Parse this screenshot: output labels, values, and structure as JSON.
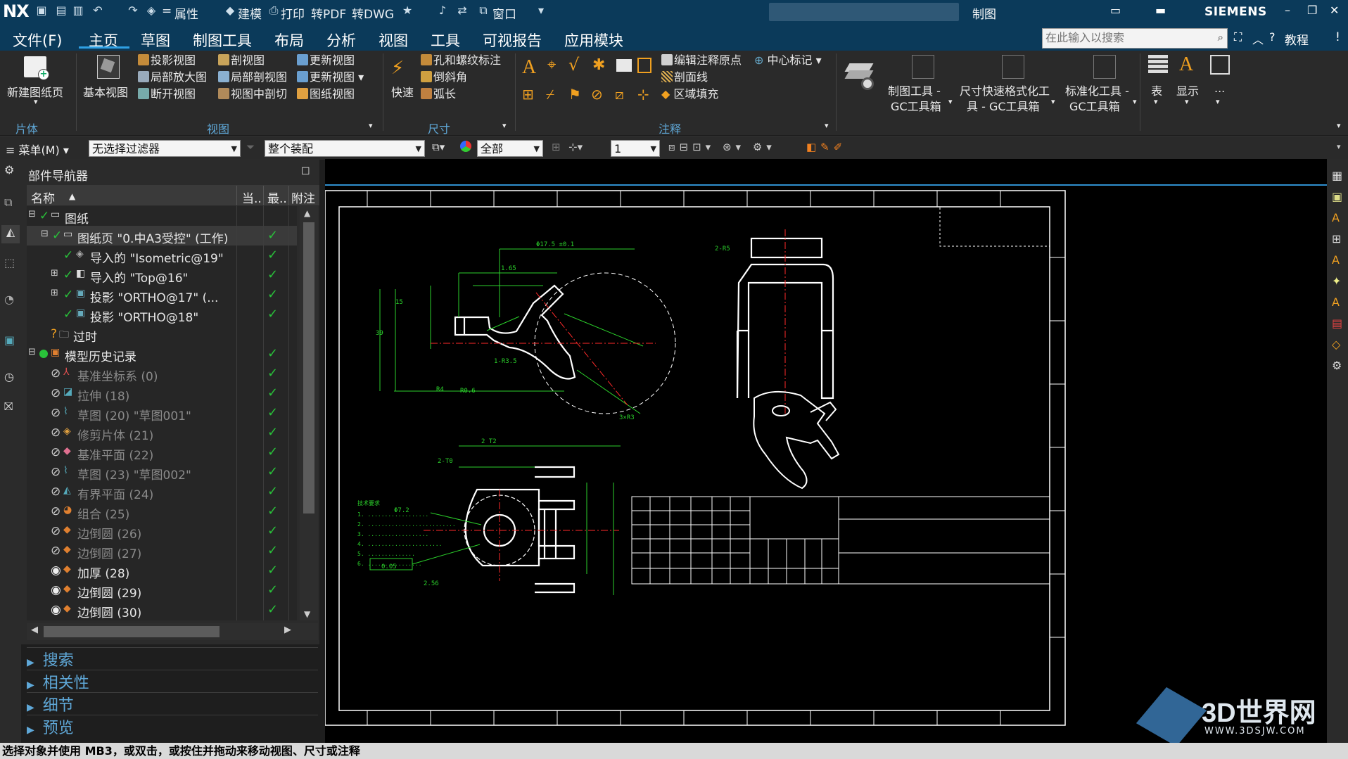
{
  "app": {
    "logo": "NX",
    "title": "制图",
    "brand": "SIEMENS"
  },
  "quick_access": {
    "properties": "属性",
    "model": "建模",
    "print": "打印",
    "to_pdf": "转PDF",
    "to_dwg": "转DWG",
    "window": "窗口"
  },
  "menu": {
    "file": "文件(F)",
    "tabs": [
      "主页",
      "草图",
      "制图工具",
      "布局",
      "分析",
      "视图",
      "工具",
      "可视报告",
      "应用模块"
    ],
    "active_tab": "主页",
    "search_placeholder": "在此输入以搜索",
    "tutorial": "教程"
  },
  "ribbon": {
    "new_sheet": "新建图纸页",
    "base_view": "基本视图",
    "projected_view": "投影视图",
    "detail_view": "局部放大图",
    "break_view": "断开视图",
    "section_view": "剖视图",
    "local_section": "局部剖视图",
    "view_in_section": "视图中剖切",
    "update_view_1": "更新视图",
    "update_view_2": "更新视图",
    "sheet_view": "图纸视图",
    "quick": "快速",
    "hole_thread": "孔和螺纹标注",
    "chamfer": "倒斜角",
    "arc_length": "弧长",
    "edit_origin": "编辑注释原点",
    "center_mark": "中心标记",
    "hatch": "剖面线",
    "area_fill": "区域填充",
    "drafting_tools": "制图工具 -",
    "gc_toolbox_1": "GC工具箱",
    "dim_quick_format": "尺寸快速格式化工",
    "gc_toolbox_2": "具 - GC工具箱",
    "standardize": "标准化工具 -",
    "gc_toolbox_3": "GC工具箱",
    "table": "表",
    "display": "显示",
    "more": "...",
    "groups": {
      "sheet": "片体",
      "view": "视图",
      "dimension": "尺寸",
      "annotation": "注释"
    }
  },
  "filterbar": {
    "menu": "菜单(M)",
    "filter": "无选择过滤器",
    "assembly": "整个装配",
    "scope": "全部",
    "layer": "1"
  },
  "navigator": {
    "title": "部件导航器",
    "headers": {
      "name": "名称",
      "current": "当..",
      "latest": "最..",
      "note": "附注"
    },
    "rows": [
      {
        "label": "图纸",
        "check": false
      },
      {
        "label": "图纸页 \"0.中A3受控\" (工作)",
        "check": true
      },
      {
        "label": "导入的 \"Isometric@19\"",
        "check": true
      },
      {
        "label": "导入的 \"Top@16\"",
        "check": true
      },
      {
        "label": "投影 \"ORTHO@17\" (...",
        "check": true
      },
      {
        "label": "投影 \"ORTHO@18\"",
        "check": true
      },
      {
        "label": "过时",
        "check": false
      },
      {
        "label": "模型历史记录",
        "check": true
      },
      {
        "label": "基准坐标系 (0)",
        "check": true
      },
      {
        "label": "拉伸 (18)",
        "check": true
      },
      {
        "label": "草图 (20) \"草图001\"",
        "check": true
      },
      {
        "label": "修剪片体 (21)",
        "check": true
      },
      {
        "label": "基准平面 (22)",
        "check": true
      },
      {
        "label": "草图 (23) \"草图002\"",
        "check": true
      },
      {
        "label": "有界平面 (24)",
        "check": true
      },
      {
        "label": "组合 (25)",
        "check": true
      },
      {
        "label": "边倒圆 (26)",
        "check": true
      },
      {
        "label": "边倒圆 (27)",
        "check": true
      },
      {
        "label": "加厚 (28)",
        "check": true
      },
      {
        "label": "边倒圆 (29)",
        "check": true
      },
      {
        "label": "边倒圆 (30)",
        "check": true
      }
    ],
    "panels": [
      "搜索",
      "相关性",
      "细节",
      "预览"
    ]
  },
  "status_text": "选择对象并使用 MB3，或双击，或按住并拖动来移动视图、尺寸或注释",
  "watermark": {
    "name": "3D世界网",
    "url": "WWW.3DSJW.COM"
  },
  "colors": {
    "accent": "#2fa0e4",
    "titlebar": "#0b3a5a",
    "check": "#29c23a",
    "drawing_line": "#ffffff",
    "dim_line": "#2bd12b",
    "center_line": "#ff2a2a"
  }
}
